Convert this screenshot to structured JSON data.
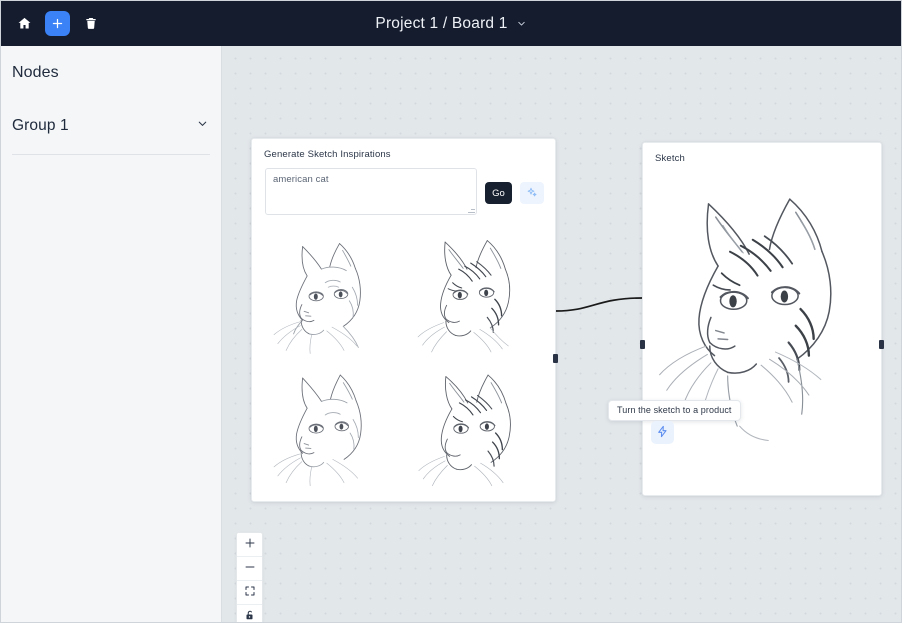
{
  "topbar": {
    "home_icon": "home-icon",
    "add_icon": "plus-icon",
    "delete_icon": "trash-icon",
    "title": "Project 1 / Board 1",
    "caret_icon": "chevron-down-icon",
    "accent_color": "#3b82f6",
    "background_color": "#141c2e"
  },
  "sidebar": {
    "title": "Nodes",
    "groups": [
      {
        "label": "Group 1",
        "caret_icon": "chevron-down-icon"
      }
    ]
  },
  "canvas": {
    "background_color": "#e2e7ea",
    "dot_color": "#d2d8dd"
  },
  "nodes": [
    {
      "id": "generate",
      "label": "Generate Sketch Inspirations",
      "prompt": {
        "value": "american cat",
        "placeholder": "Describe your sketch"
      },
      "buttons": {
        "go_label": "Go",
        "magic_icon": "sparkle-icon"
      },
      "images": [
        "cat-sketch-1",
        "cat-sketch-2",
        "cat-sketch-3",
        "cat-sketch-4"
      ]
    },
    {
      "id": "sketch",
      "label": "Sketch",
      "image": "cat-sketch-large"
    }
  ],
  "tooltip": {
    "text": "Turn the sketch to a product"
  },
  "action_button": {
    "icon": "lightning-bolt-icon",
    "color": "#5b8def",
    "background": "#eaf2fe"
  },
  "zoom_controls": [
    {
      "name": "zoom-in",
      "icon": "plus-icon"
    },
    {
      "name": "zoom-out",
      "icon": "minus-icon"
    },
    {
      "name": "fit-view",
      "icon": "fit-view-icon"
    },
    {
      "name": "lock-toggle",
      "icon": "lock-icon"
    }
  ]
}
